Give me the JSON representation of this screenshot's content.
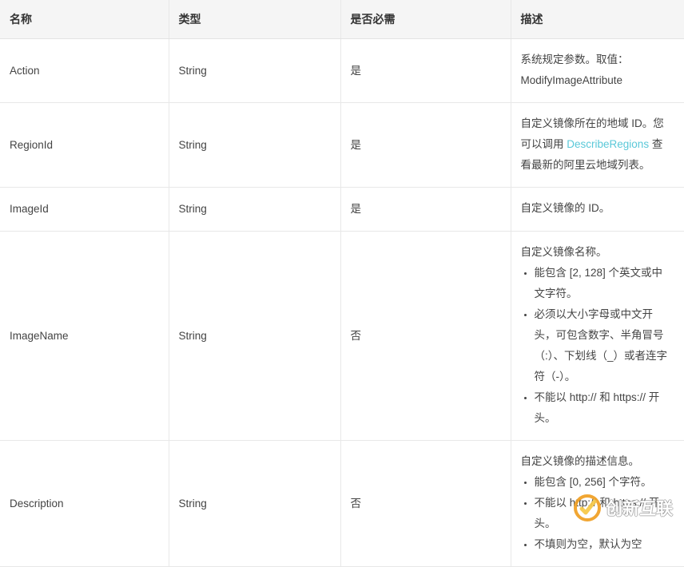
{
  "table": {
    "headers": [
      "名称",
      "类型",
      "是否必需",
      "描述"
    ],
    "rows": [
      {
        "name": "Action",
        "type": "String",
        "required": "是",
        "desc_lead": "系统规定参数。取值：ModifyImageAttribute",
        "desc_bullets": []
      },
      {
        "name": "RegionId",
        "type": "String",
        "required": "是",
        "desc_lead_pre": "自定义镜像所在的地域 ID。您可以调用 ",
        "desc_link": "DescribeRegions",
        "desc_lead_post": " 查看最新的阿里云地域列表。",
        "desc_bullets": []
      },
      {
        "name": "ImageId",
        "type": "String",
        "required": "是",
        "desc_lead": "自定义镜像的 ID。",
        "desc_bullets": []
      },
      {
        "name": "ImageName",
        "type": "String",
        "required": "否",
        "desc_lead": "自定义镜像名称。",
        "desc_bullets": [
          "能包含 [2, 128] 个英文或中文字符。",
          "必须以大小字母或中文开头，可包含数字、半角冒号（:）、下划线（_）或者连字符（-）。",
          "不能以 http:// 和 https:// 开头。"
        ]
      },
      {
        "name": "Description",
        "type": "String",
        "required": "否",
        "desc_lead": "自定义镜像的描述信息。",
        "desc_bullets": [
          "能包含 [0, 256] 个字符。",
          "不能以 http:// 和 https:// 开头。",
          "不填则为空，默认为空"
        ]
      }
    ]
  },
  "watermark": {
    "text": "创新互联",
    "logo_color": "#f5a623",
    "check_color": "#f7c948"
  },
  "colors": {
    "link": "#5ac8d8",
    "header_bg": "#f5f5f5",
    "border": "#e8e8e8",
    "text": "#444444"
  }
}
